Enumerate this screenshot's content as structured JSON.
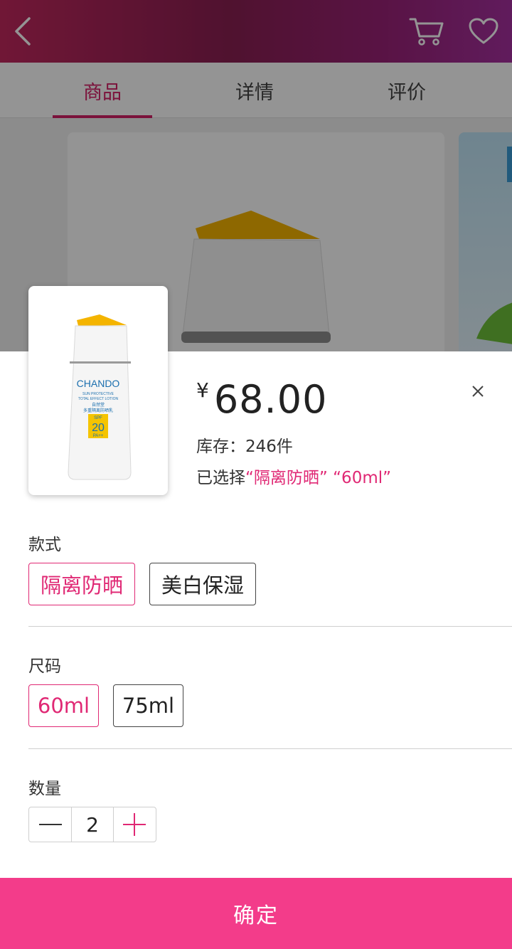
{
  "header": {
    "back_icon": "chevron-left-icon",
    "cart_icon": "cart-icon",
    "favorite_icon": "heart-icon",
    "gradient": [
      "#c2285e",
      "#8a1f52",
      "#a630a0"
    ]
  },
  "tabs": [
    {
      "label": "商品",
      "active": true
    },
    {
      "label": "详情",
      "active": false
    },
    {
      "label": "评价",
      "active": false
    }
  ],
  "product": {
    "currency": "¥",
    "price": "68.00",
    "stock": "库存：246件",
    "selected_prefix": "已选择",
    "selected_values": "“隔离防晒” “60ml”",
    "thumb_brand": "CHANDO",
    "thumb_line1": "SUN PROTECTIVE",
    "thumb_line2": "TOTAL EFFECT LOTION",
    "thumb_cn": "自然堂",
    "thumb_cn2": "多重隔离防晒乳",
    "spf_label": "SPF",
    "spf_value": "20",
    "pa_label": "PA++"
  },
  "style_section": {
    "label": "款式",
    "options": [
      {
        "label": "隔离防晒",
        "active": true
      },
      {
        "label": "美白保湿",
        "active": false
      }
    ]
  },
  "size_section": {
    "label": "尺码",
    "options": [
      {
        "label": "60ml",
        "active": true
      },
      {
        "label": "75ml",
        "active": false
      }
    ]
  },
  "quantity_section": {
    "label": "数量",
    "value": "2"
  },
  "confirm_label": "确定",
  "colors": {
    "accent": "#e02874",
    "confirm_bg": "#f33c8a"
  }
}
